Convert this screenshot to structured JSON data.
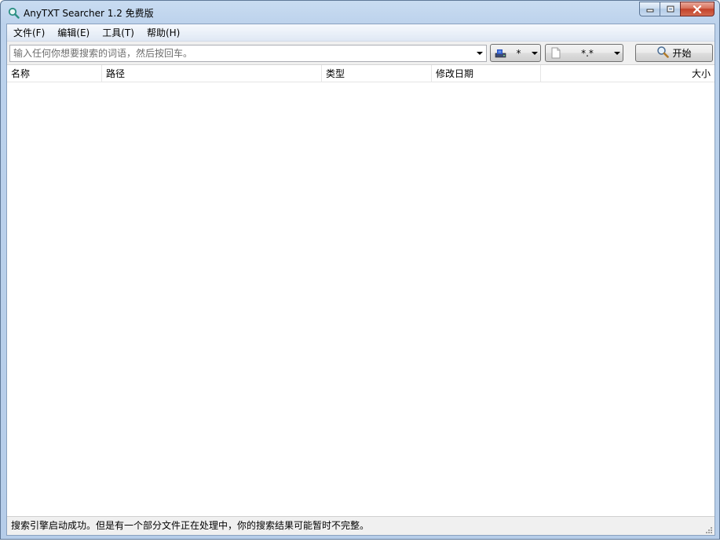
{
  "window": {
    "title": "AnyTXT Searcher 1.2 免费版",
    "min_glyph": "▭",
    "max_glyph": "□",
    "close_glyph": "✕"
  },
  "menu": [
    "文件(F)",
    "编辑(E)",
    "工具(T)",
    "帮助(H)"
  ],
  "search": {
    "placeholder": "输入任何你想要搜索的词语，然后按回车。",
    "value": ""
  },
  "drive_filter": {
    "value": "*",
    "icon": "drive-icon"
  },
  "type_filter": {
    "value": "*.*",
    "icon": "file-icon"
  },
  "start_button": {
    "label": "开始",
    "icon": "search-icon"
  },
  "columns": {
    "name": "名称",
    "path": "路径",
    "type": "类型",
    "date": "修改日期",
    "size": "大小"
  },
  "status": "搜索引擎启动成功。但是有一个部分文件正在处理中，你的搜索结果可能暂时不完整。",
  "colors": {
    "title_bg": "#c9dcf1",
    "close_bg": "#c3422a",
    "accent": "#3b78d0"
  }
}
